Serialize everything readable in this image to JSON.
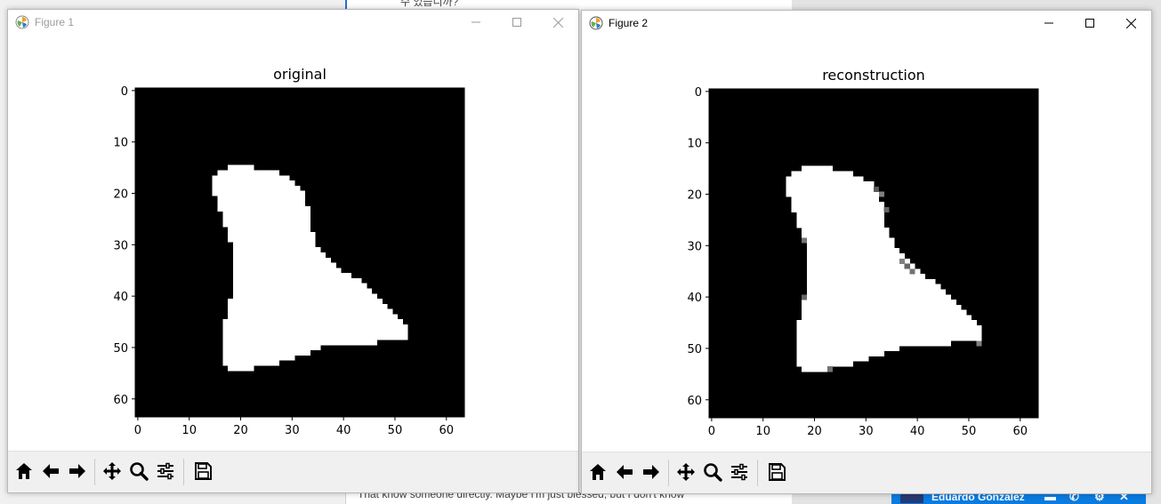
{
  "background": {
    "doc_lines": [
      {
        "text": "수 있습니까?"
      },
      {
        "text": "That know someone directly. Maybe I'm just blessed, but I don't know"
      }
    ],
    "chat": {
      "name": "Eduardo Gonzalez"
    }
  },
  "figure1": {
    "window_title": "Figure 1",
    "state": "inactive",
    "toolbar_icons": [
      "home-icon",
      "back-arrow-icon",
      "forward-arrow-icon",
      "pan-icon",
      "zoom-icon",
      "configure-subplots-icon",
      "save-icon"
    ]
  },
  "figure2": {
    "window_title": "Figure 2",
    "state": "active",
    "toolbar_icons": [
      "home-icon",
      "back-arrow-icon",
      "forward-arrow-icon",
      "pan-icon",
      "zoom-icon",
      "configure-subplots-icon",
      "save-icon"
    ]
  },
  "chart_data": [
    {
      "type": "heatmap",
      "title": "original",
      "colormap": "gray",
      "shape": [
        64,
        64
      ],
      "xlim": [
        -0.5,
        63.5
      ],
      "ylim": [
        63.5,
        -0.5
      ],
      "xticks": [
        0,
        10,
        20,
        30,
        40,
        50,
        60
      ],
      "yticks": [
        0,
        10,
        20,
        30,
        40,
        50,
        60
      ],
      "white_region_runs": [
        {
          "row": 15,
          "x_start": 18,
          "x_end": 22
        },
        {
          "row": 16,
          "x_start": 16,
          "x_end": 27
        },
        {
          "row": 17,
          "x_start": 15,
          "x_end": 29
        },
        {
          "row": 18,
          "x_start": 15,
          "x_end": 30
        },
        {
          "row": 19,
          "x_start": 15,
          "x_end": 31
        },
        {
          "row": 20,
          "x_start": 15,
          "x_end": 32
        },
        {
          "row": 21,
          "x_start": 16,
          "x_end": 32
        },
        {
          "row": 22,
          "x_start": 16,
          "x_end": 32
        },
        {
          "row": 23,
          "x_start": 16,
          "x_end": 33
        },
        {
          "row": 24,
          "x_start": 17,
          "x_end": 33
        },
        {
          "row": 25,
          "x_start": 17,
          "x_end": 33
        },
        {
          "row": 26,
          "x_start": 17,
          "x_end": 33
        },
        {
          "row": 27,
          "x_start": 18,
          "x_end": 33
        },
        {
          "row": 28,
          "x_start": 18,
          "x_end": 34
        },
        {
          "row": 29,
          "x_start": 18,
          "x_end": 34
        },
        {
          "row": 30,
          "x_start": 19,
          "x_end": 34
        },
        {
          "row": 31,
          "x_start": 19,
          "x_end": 35
        },
        {
          "row": 32,
          "x_start": 19,
          "x_end": 36
        },
        {
          "row": 33,
          "x_start": 19,
          "x_end": 37
        },
        {
          "row": 34,
          "x_start": 19,
          "x_end": 38
        },
        {
          "row": 35,
          "x_start": 19,
          "x_end": 39
        },
        {
          "row": 36,
          "x_start": 19,
          "x_end": 41
        },
        {
          "row": 37,
          "x_start": 19,
          "x_end": 43
        },
        {
          "row": 38,
          "x_start": 19,
          "x_end": 44
        },
        {
          "row": 39,
          "x_start": 19,
          "x_end": 45
        },
        {
          "row": 40,
          "x_start": 19,
          "x_end": 46
        },
        {
          "row": 41,
          "x_start": 18,
          "x_end": 47
        },
        {
          "row": 42,
          "x_start": 18,
          "x_end": 48
        },
        {
          "row": 43,
          "x_start": 18,
          "x_end": 49
        },
        {
          "row": 44,
          "x_start": 18,
          "x_end": 50
        },
        {
          "row": 45,
          "x_start": 17,
          "x_end": 51
        },
        {
          "row": 46,
          "x_start": 17,
          "x_end": 52
        },
        {
          "row": 47,
          "x_start": 17,
          "x_end": 52
        },
        {
          "row": 48,
          "x_start": 17,
          "x_end": 52
        },
        {
          "row": 49,
          "x_start": 17,
          "x_end": 46
        },
        {
          "row": 50,
          "x_start": 17,
          "x_end": 35
        },
        {
          "row": 51,
          "x_start": 17,
          "x_end": 33
        },
        {
          "row": 52,
          "x_start": 17,
          "x_end": 30
        },
        {
          "row": 53,
          "x_start": 17,
          "x_end": 27
        },
        {
          "row": 54,
          "x_start": 18,
          "x_end": 22
        }
      ]
    },
    {
      "type": "heatmap",
      "title": "reconstruction",
      "colormap": "gray",
      "shape": [
        64,
        64
      ],
      "xlim": [
        -0.5,
        63.5
      ],
      "ylim": [
        63.5,
        -0.5
      ],
      "xticks": [
        0,
        10,
        20,
        30,
        40,
        50,
        60
      ],
      "yticks": [
        0,
        10,
        20,
        30,
        40,
        50,
        60
      ],
      "white_region_runs": [
        {
          "row": 15,
          "x_start": 18,
          "x_end": 23
        },
        {
          "row": 16,
          "x_start": 16,
          "x_end": 27
        },
        {
          "row": 17,
          "x_start": 15,
          "x_end": 29
        },
        {
          "row": 18,
          "x_start": 15,
          "x_end": 31
        },
        {
          "row": 19,
          "x_start": 15,
          "x_end": 31
        },
        {
          "row": 20,
          "x_start": 15,
          "x_end": 32
        },
        {
          "row": 21,
          "x_start": 16,
          "x_end": 32
        },
        {
          "row": 22,
          "x_start": 16,
          "x_end": 33
        },
        {
          "row": 23,
          "x_start": 16,
          "x_end": 33
        },
        {
          "row": 24,
          "x_start": 17,
          "x_end": 33
        },
        {
          "row": 25,
          "x_start": 17,
          "x_end": 33
        },
        {
          "row": 26,
          "x_start": 17,
          "x_end": 33
        },
        {
          "row": 27,
          "x_start": 18,
          "x_end": 34
        },
        {
          "row": 28,
          "x_start": 18,
          "x_end": 34
        },
        {
          "row": 29,
          "x_start": 18,
          "x_end": 35
        },
        {
          "row": 30,
          "x_start": 19,
          "x_end": 35
        },
        {
          "row": 31,
          "x_start": 19,
          "x_end": 36
        },
        {
          "row": 32,
          "x_start": 19,
          "x_end": 37
        },
        {
          "row": 33,
          "x_start": 19,
          "x_end": 38
        },
        {
          "row": 34,
          "x_start": 19,
          "x_end": 39
        },
        {
          "row": 35,
          "x_start": 19,
          "x_end": 40
        },
        {
          "row": 36,
          "x_start": 19,
          "x_end": 41
        },
        {
          "row": 37,
          "x_start": 19,
          "x_end": 43
        },
        {
          "row": 38,
          "x_start": 19,
          "x_end": 44
        },
        {
          "row": 39,
          "x_start": 19,
          "x_end": 45
        },
        {
          "row": 40,
          "x_start": 19,
          "x_end": 46
        },
        {
          "row": 41,
          "x_start": 18,
          "x_end": 47
        },
        {
          "row": 42,
          "x_start": 18,
          "x_end": 48
        },
        {
          "row": 43,
          "x_start": 18,
          "x_end": 49
        },
        {
          "row": 44,
          "x_start": 18,
          "x_end": 50
        },
        {
          "row": 45,
          "x_start": 17,
          "x_end": 51
        },
        {
          "row": 46,
          "x_start": 17,
          "x_end": 52
        },
        {
          "row": 47,
          "x_start": 17,
          "x_end": 52
        },
        {
          "row": 48,
          "x_start": 17,
          "x_end": 52
        },
        {
          "row": 49,
          "x_start": 17,
          "x_end": 46
        },
        {
          "row": 50,
          "x_start": 17,
          "x_end": 36
        },
        {
          "row": 51,
          "x_start": 17,
          "x_end": 33
        },
        {
          "row": 52,
          "x_start": 17,
          "x_end": 30
        },
        {
          "row": 53,
          "x_start": 17,
          "x_end": 27
        },
        {
          "row": 54,
          "x_start": 18,
          "x_end": 22
        }
      ],
      "gray_pixels": [
        {
          "row": 19,
          "col": 32,
          "value": 0.35
        },
        {
          "row": 20,
          "col": 33,
          "value": 0.5
        },
        {
          "row": 23,
          "col": 34,
          "value": 0.4
        },
        {
          "row": 29,
          "col": 18,
          "value": 0.45
        },
        {
          "row": 33,
          "col": 37,
          "value": 0.5
        },
        {
          "row": 34,
          "col": 38,
          "value": 0.4
        },
        {
          "row": 35,
          "col": 39,
          "value": 0.45
        },
        {
          "row": 40,
          "col": 18,
          "value": 0.4
        },
        {
          "row": 49,
          "col": 52,
          "value": 0.5
        },
        {
          "row": 54,
          "col": 23,
          "value": 0.45
        }
      ]
    }
  ]
}
